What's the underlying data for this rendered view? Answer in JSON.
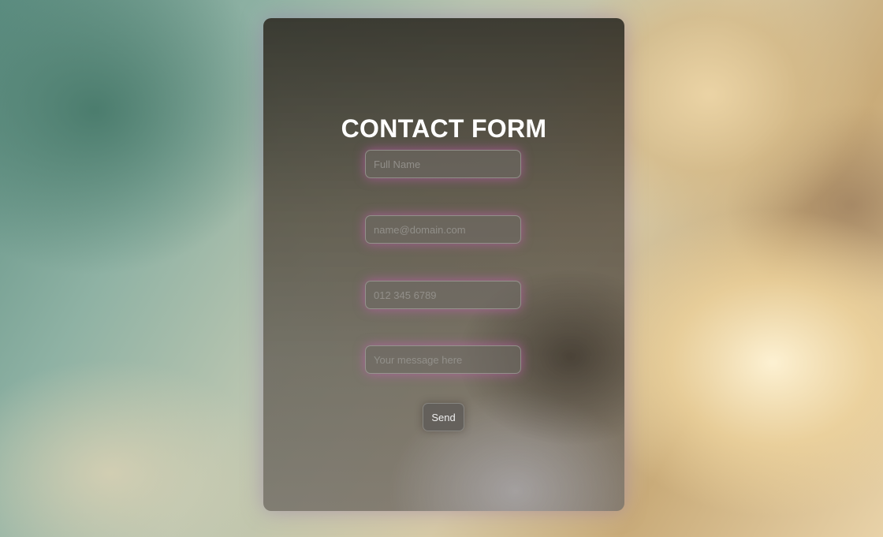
{
  "form": {
    "title": "CONTACT FORM",
    "fields": [
      {
        "name": "full-name",
        "placeholder": "Full Name",
        "value": ""
      },
      {
        "name": "email",
        "placeholder": "name@domain.com",
        "value": ""
      },
      {
        "name": "phone",
        "placeholder": "012 345 6789",
        "value": ""
      },
      {
        "name": "message",
        "placeholder": "Your message here",
        "value": ""
      }
    ],
    "send_label": "Send"
  },
  "colors": {
    "title": "#ffffff",
    "field_glow": "#dc5ac8",
    "card_shadow": "#9678aa"
  }
}
